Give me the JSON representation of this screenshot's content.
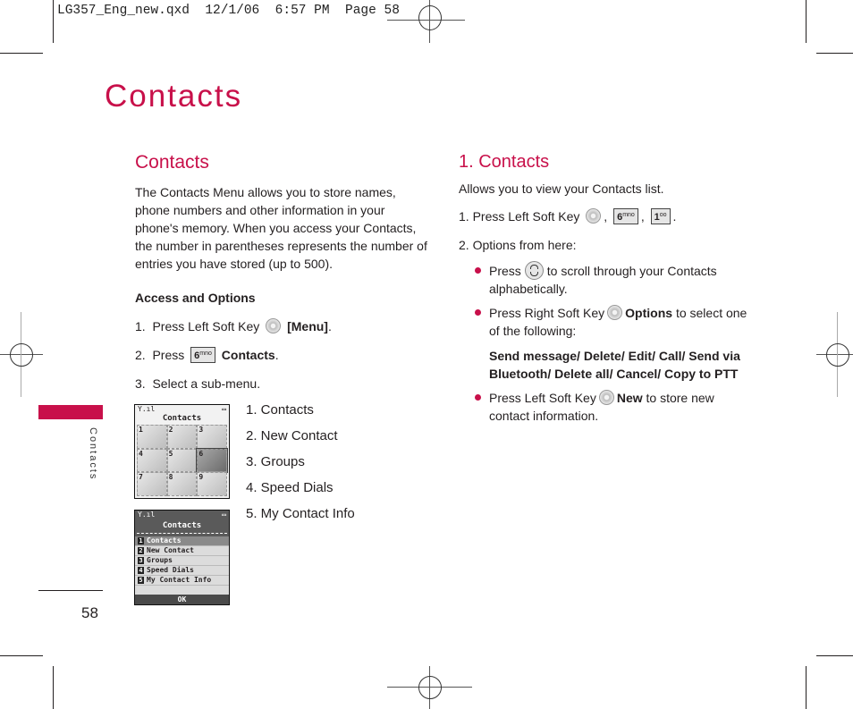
{
  "slug": {
    "file": "LG357_Eng_new.qxd",
    "date": "12/1/06",
    "time": "6:57 PM",
    "page_label": "Page 58"
  },
  "page_title": "Contacts",
  "side_tab": {
    "label": "Contacts",
    "color": "#c8104a"
  },
  "page_number": "58",
  "left": {
    "heading": "Contacts",
    "intro": "The Contacts Menu allows you to store names, phone numbers and other information in your phone's memory. When you access your Contacts, the number in parentheses represents the number of entries you have stored (up to 500).",
    "intro_lines": [
      "The Contacts Menu allows you to store names,",
      "phone numbers and other information in your",
      "phone's memory. When you access your Contacts,",
      "the number in parentheses represents the number of",
      "entries you have stored (up to 500)."
    ],
    "access_heading": "Access and Options",
    "steps": [
      {
        "num": "1.",
        "text": "Press Left Soft Key",
        "key": "left-soft-key",
        "after": "[Menu]",
        "end": "."
      },
      {
        "num": "2.",
        "text": "Press",
        "key_label": "6",
        "key_sub": "mno",
        "after": "Contacts",
        "end": "."
      },
      {
        "num": "3.",
        "text": "Select a sub-menu."
      }
    ],
    "submenu": [
      "1. Contacts",
      "2. New Contact",
      "3. Groups",
      "4. Speed Dials",
      "5. My Contact Info"
    ],
    "grid_screen": {
      "title": "Contacts",
      "signal": "Y.ıl",
      "battery": "▭",
      "cells": [
        "1",
        "2",
        "3",
        "4",
        "5",
        "6",
        "7",
        "8",
        "9"
      ],
      "selected": "6"
    },
    "list_screen": {
      "title": "Contacts",
      "signal": "Y.ıl",
      "battery": "▭",
      "items": [
        {
          "num": "1",
          "label": "Contacts"
        },
        {
          "num": "2",
          "label": "New Contact"
        },
        {
          "num": "3",
          "label": "Groups"
        },
        {
          "num": "4",
          "label": "Speed Dials"
        },
        {
          "num": "5",
          "label": "My Contact Info"
        }
      ],
      "selected": "1",
      "footer": "OK"
    }
  },
  "right": {
    "heading": "1. Contacts",
    "intro": "Allows you to view your Contacts list.",
    "step1": {
      "text": "1. Press Left Soft Key",
      "key1_label": "6",
      "key1_sub": "mno",
      "key2_label": "1",
      "key2_sub": "oo",
      "sep": ",",
      "end": "."
    },
    "step2": "2. Options from here:",
    "bullets": [
      {
        "pre": "Press",
        "key": "navigation-key",
        "line1_rest": "to scroll through your Contacts",
        "line2": "alphabetically."
      },
      {
        "pre": "Press Right Soft Key",
        "key": "right-soft-key",
        "bold": "Options",
        "line1_rest": "to select one",
        "line2": "of the following:"
      },
      {
        "pre": "Press Left Soft Key",
        "key": "left-soft-key",
        "bold": "New",
        "line1_rest": "to store new",
        "line2": "contact information."
      }
    ],
    "options_line1": "Send message/ Delete/ Edit/ Call/ Send via",
    "options_line2": "Bluetooth/ Delete all/ Cancel/ Copy to PTT"
  }
}
